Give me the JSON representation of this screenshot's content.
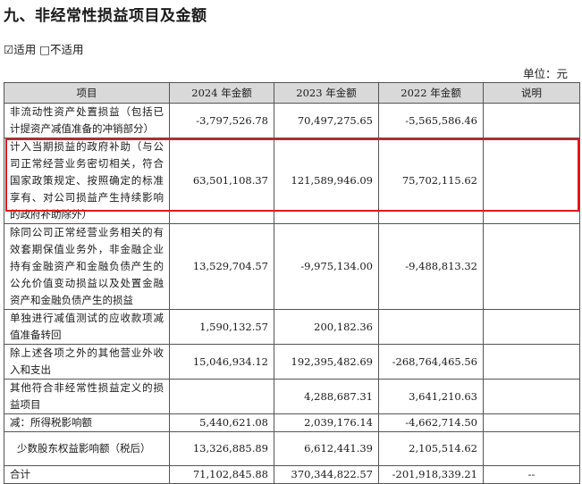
{
  "section_title": "九、非经常性损益项目及金额",
  "applicability": {
    "applicable_label": "☑适用",
    "not_applicable_label": "□不适用"
  },
  "unit_label": "单位：元",
  "table": {
    "headers": [
      "项目",
      "2024 年金额",
      "2023 年金额",
      "2022 年金额",
      "说明"
    ],
    "rows": [
      {
        "item": "非流动性资产处置损益（包括已计提资产减值准备的冲销部分）",
        "y2024": "-3,797,526.78",
        "y2023": "70,497,275.65",
        "y2022": "-5,565,586.46",
        "note": ""
      },
      {
        "item": "计入当期损益的政府补助（与公司正常经营业务密切相关，符合国家政策规定、按照确定的标准享有、对公司损益产生持续影响的政府补助除外）",
        "y2024": "63,501,108.37",
        "y2023": "121,589,946.09",
        "y2022": "75,702,115.62",
        "note": ""
      },
      {
        "item": "除同公司正常经营业务相关的有效套期保值业务外，非金融企业持有金融资产和金融负债产生的公允价值变动损益以及处置金融资产和金融负债产生的损益",
        "y2024": "13,529,704.57",
        "y2023": "-9,975,134.00",
        "y2022": "-9,488,813.32",
        "note": ""
      },
      {
        "item": "单独进行减值测试的应收款项减值准备转回",
        "y2024": "1,590,132.57",
        "y2023": "200,182.36",
        "y2022": "",
        "note": ""
      },
      {
        "item": "除上述各项之外的其他营业外收入和支出",
        "y2024": "15,046,934.12",
        "y2023": "192,395,482.69",
        "y2022": "-268,764,465.56",
        "note": ""
      },
      {
        "item": "其他符合非经常性损益定义的损益项目",
        "y2024": "",
        "y2023": "4,288,687.31",
        "y2022": "3,641,210.63",
        "note": ""
      },
      {
        "item": "减：所得税影响额",
        "y2024": "5,440,621.08",
        "y2023": "2,039,176.14",
        "y2022": "-4,662,714.50",
        "note": ""
      },
      {
        "item": "少数股东权益影响额（税后）",
        "y2024": "13,326,885.89",
        "y2023": "6,612,441.39",
        "y2022": "2,105,514.62",
        "note": ""
      },
      {
        "item": "合计",
        "y2024": "71,102,845.88",
        "y2023": "370,344,822.57",
        "y2022": "-201,918,339.21",
        "note": "--"
      }
    ]
  },
  "highlight_color": "#e0191c"
}
